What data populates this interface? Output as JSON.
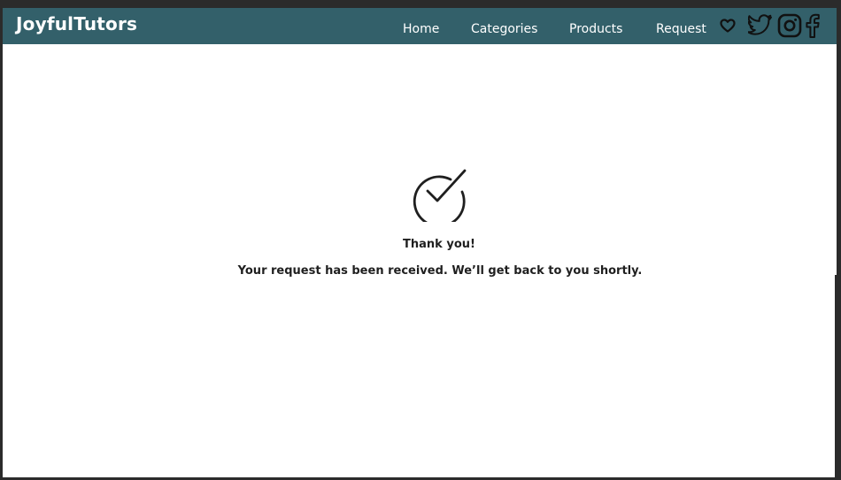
{
  "brand": {
    "name": "JoyfulTutors"
  },
  "nav": {
    "links": [
      {
        "label": "Home"
      },
      {
        "label": "Categories"
      },
      {
        "label": "Products"
      },
      {
        "label": "Request"
      }
    ]
  },
  "icons": {
    "heart": "heart-icon",
    "twitter": "twitter-icon",
    "instagram": "instagram-icon",
    "facebook": "facebook-icon",
    "check": "check-circle-icon"
  },
  "confirmation": {
    "title": "Thank you!",
    "message": "Your request has been received. We’ll get back to you shortly."
  },
  "colors": {
    "navbar": "#33606a",
    "text": "#1f1f1f",
    "background": "#ffffff"
  }
}
